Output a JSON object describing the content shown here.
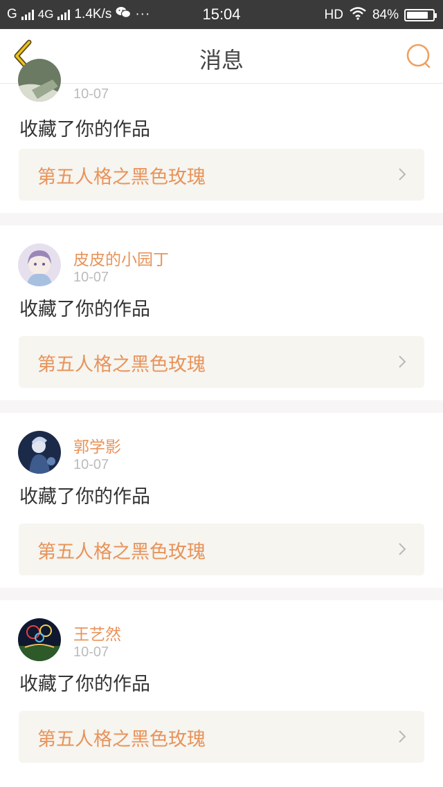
{
  "status_bar": {
    "carrier": "G",
    "network": "4G",
    "speed": "1.4K/s",
    "dots": "···",
    "time": "15:04",
    "hd": "HD",
    "battery_text": "84%",
    "battery_level": 0.84
  },
  "nav": {
    "title": "消息"
  },
  "messages": [
    {
      "username": "",
      "date": "10-07",
      "action": "收藏了你的作品",
      "work_title": "第五人格之黑色玫瑰"
    },
    {
      "username": "皮皮的小园丁",
      "date": "10-07",
      "action": "收藏了你的作品",
      "work_title": "第五人格之黑色玫瑰"
    },
    {
      "username": "郭学影",
      "date": "10-07",
      "action": "收藏了你的作品",
      "work_title": "第五人格之黑色玫瑰"
    },
    {
      "username": "王艺然",
      "date": "10-07",
      "action": "收藏了你的作品",
      "work_title": "第五人格之黑色玫瑰"
    }
  ],
  "colors": {
    "accent": "#e8935a",
    "back_icon": "#f0c419",
    "statusbar_bg": "#3a3a3a"
  },
  "icons": {
    "back": "chevron-left-icon",
    "search": "search-icon",
    "chevron": "chevron-right-icon",
    "wechat": "wechat-icon",
    "wifi": "wifi-icon"
  }
}
